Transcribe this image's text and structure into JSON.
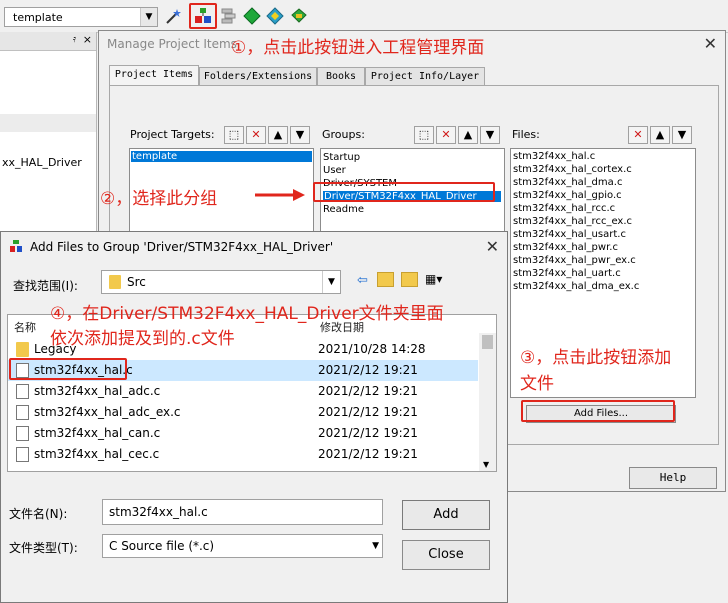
{
  "toolbar": {
    "target_value": "template",
    "icons": [
      "wand-icon",
      "manage-project-icon",
      "stack-icon",
      "green-diamond-icon",
      "yellow-diamond-icon",
      "books-icon"
    ]
  },
  "left_panel": {
    "item": "xx_HAL_Driver"
  },
  "manage_dialog": {
    "title": "Manage Project Items",
    "tabs": [
      "Project Items",
      "Folders/Extensions",
      "Books",
      "Project Info/Layer"
    ],
    "targets_label": "Project Targets:",
    "targets": [
      "template"
    ],
    "groups_label": "Groups:",
    "groups": [
      "Startup",
      "User",
      "Driver/SYSTEM",
      "Driver/STM32F4xx_HAL_Driver",
      "Readme"
    ],
    "files_label": "Files:",
    "files": [
      "stm32f4xx_hal.c",
      "stm32f4xx_hal_cortex.c",
      "stm32f4xx_hal_dma.c",
      "stm32f4xx_hal_gpio.c",
      "stm32f4xx_hal_rcc.c",
      "stm32f4xx_hal_rcc_ex.c",
      "stm32f4xx_hal_usart.c",
      "stm32f4xx_hal_pwr.c",
      "stm32f4xx_hal_pwr_ex.c",
      "stm32f4xx_hal_uart.c",
      "stm32f4xx_hal_dma_ex.c"
    ],
    "add_files_label": "Add Files...",
    "help_label": "Help"
  },
  "add_dialog": {
    "title": "Add Files to Group 'Driver/STM32F4xx_HAL_Driver'",
    "look_in_label": "查找范围(I):",
    "look_in_value": "Src",
    "col_name": "名称",
    "col_date": "修改日期",
    "rows": [
      {
        "name": "Legacy",
        "date": "2021/10/28 14:28",
        "type": "folder"
      },
      {
        "name": "stm32f4xx_hal.c",
        "date": "2021/2/12 19:21",
        "type": "file"
      },
      {
        "name": "stm32f4xx_hal_adc.c",
        "date": "2021/2/12 19:21",
        "type": "file"
      },
      {
        "name": "stm32f4xx_hal_adc_ex.c",
        "date": "2021/2/12 19:21",
        "type": "file"
      },
      {
        "name": "stm32f4xx_hal_can.c",
        "date": "2021/2/12 19:21",
        "type": "file"
      },
      {
        "name": "stm32f4xx_hal_cec.c",
        "date": "2021/2/12 19:21",
        "type": "file"
      }
    ],
    "filename_label": "文件名(N):",
    "filename_value": "stm32f4xx_hal.c",
    "filetype_label": "文件类型(T):",
    "filetype_value": "C Source file (*.c)",
    "add_label": "Add",
    "close_label": "Close"
  },
  "annotations": {
    "step1": "①，点击此按钮进入工程管理界面",
    "step2": "②，选择此分组",
    "step3_line1": "③，点击此按钮添加",
    "step3_line2": "文件",
    "step4_line1": "④，在Driver/STM32F4xx_HAL_Driver文件夹里面",
    "step4_line2": "依次添加提及到的.c文件"
  },
  "colors": {
    "annotation": "#e0261c",
    "selection": "#0078d7",
    "row_highlight": "#cce8ff"
  }
}
